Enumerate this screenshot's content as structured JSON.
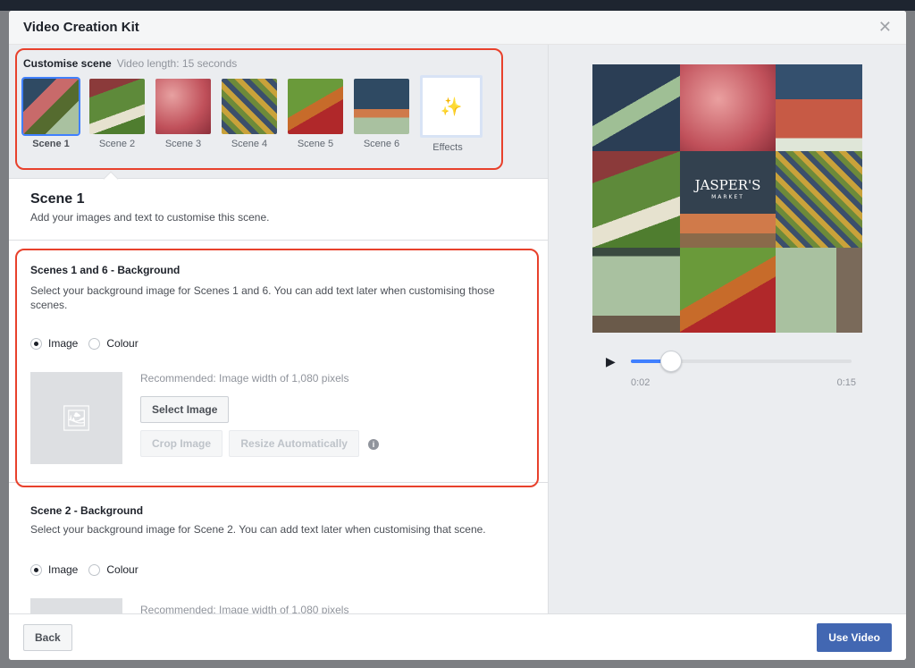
{
  "modal": {
    "title": "Video Creation Kit",
    "close_icon": "close-icon"
  },
  "strip": {
    "title": "Customise scene",
    "subtitle": "Video length: 15 seconds",
    "scenes": [
      {
        "label": "Scene 1",
        "selected": true
      },
      {
        "label": "Scene 2"
      },
      {
        "label": "Scene 3"
      },
      {
        "label": "Scene 4"
      },
      {
        "label": "Scene 5"
      },
      {
        "label": "Scene 6"
      }
    ],
    "effects_label": "Effects"
  },
  "scene": {
    "title": "Scene 1",
    "description": "Add your images and text to customise this scene."
  },
  "bg1": {
    "title": "Scenes 1 and 6 - Background",
    "description": "Select your background image for Scenes 1 and 6. You can add text later when customising those scenes.",
    "option_image": "Image",
    "option_colour": "Colour",
    "selected": "Image",
    "recommended": "Recommended: Image width of 1,080 pixels",
    "select_image": "Select Image",
    "crop_image": "Crop Image",
    "resize": "Resize Automatically"
  },
  "bg2": {
    "title": "Scene 2 - Background",
    "description": "Select your background image for Scene 2. You can add text later when customising that scene.",
    "option_image": "Image",
    "option_colour": "Colour",
    "selected": "Image",
    "recommended": "Recommended: Image width of 1,080 pixels"
  },
  "preview": {
    "logo": "JASPER'S",
    "logo_sub": "MARKET",
    "current_time": "0:02",
    "total_time": "0:15",
    "progress": 0.133
  },
  "footer": {
    "back": "Back",
    "use_video": "Use Video"
  },
  "colors": {
    "accent": "#4267b2",
    "highlight": "#e8412c",
    "selection": "#4080ff"
  }
}
